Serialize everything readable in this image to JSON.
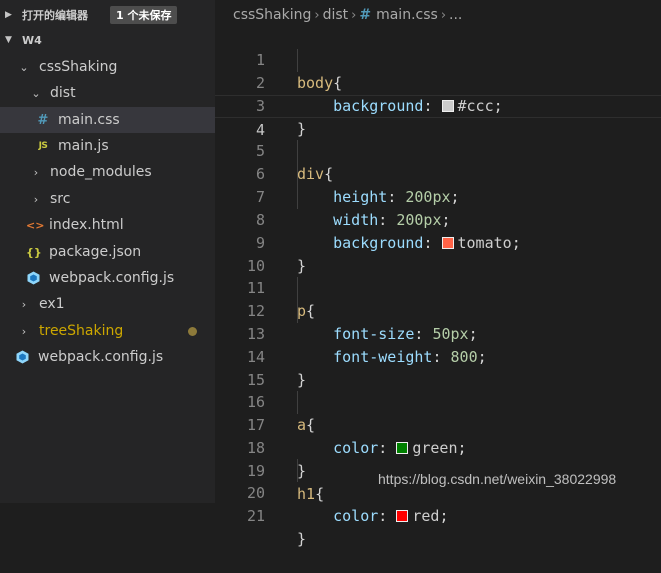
{
  "sidebar": {
    "open_editors": {
      "title": "打开的编辑器",
      "badge": "1 个未保存"
    },
    "workspace": {
      "title": "W4"
    },
    "tree": [
      {
        "label": "cssShaking",
        "kind": "folder",
        "open": true
      },
      {
        "label": "dist",
        "kind": "folder",
        "open": true
      },
      {
        "label": "main.css",
        "kind": "css",
        "icon": "#"
      },
      {
        "label": "main.js",
        "kind": "js",
        "icon": "JS"
      },
      {
        "label": "node_modules",
        "kind": "folder",
        "open": false
      },
      {
        "label": "src",
        "kind": "folder",
        "open": false
      },
      {
        "label": "index.html",
        "kind": "html",
        "icon": "<>"
      },
      {
        "label": "package.json",
        "kind": "json",
        "icon": "{}"
      },
      {
        "label": "webpack.config.js",
        "kind": "webpack"
      },
      {
        "label": "ex1",
        "kind": "folder",
        "open": false
      },
      {
        "label": "treeShaking",
        "kind": "folder",
        "open": false,
        "modified": true
      },
      {
        "label": "webpack.config.js",
        "kind": "webpack"
      }
    ]
  },
  "breadcrumb": {
    "parts": [
      "cssShaking",
      "dist",
      "main.css",
      "..."
    ],
    "file_icon": "#"
  },
  "editor": {
    "line_numbers": [
      "1",
      "2",
      "3",
      "4",
      "5",
      "6",
      "7",
      "8",
      "9",
      "10",
      "11",
      "12",
      "13",
      "14",
      "15",
      "16",
      "17",
      "18",
      "19",
      "20",
      "21"
    ],
    "code": {
      "l1_sel": "body",
      "l1_brace": "{",
      "l2_prop": "background",
      "l2_colon": ": ",
      "l2_val": "#ccc",
      "l2_semi": ";",
      "l3": "}",
      "l5_sel": "div",
      "l5_brace": "{",
      "l6_prop": "height",
      "l6_colon": ": ",
      "l6_val": "200px",
      "l6_semi": ";",
      "l7_prop": "width",
      "l7_colon": ": ",
      "l7_val": "200px",
      "l7_semi": ";",
      "l8_prop": "background",
      "l8_colon": ": ",
      "l8_val": "tomato",
      "l8_semi": ";",
      "l9": "}",
      "l11_sel": "p",
      "l11_brace": "{",
      "l12_prop": "font-size",
      "l12_colon": ": ",
      "l12_val": "50px",
      "l12_semi": ";",
      "l13_prop": "font-weight",
      "l13_colon": ": ",
      "l13_val": "800",
      "l13_semi": ";",
      "l14": "}",
      "l16_sel": "a",
      "l16_brace": "{",
      "l17_prop": "color",
      "l17_colon": ": ",
      "l17_val": "green",
      "l17_semi": ";",
      "l18": "}",
      "l19_sel": "h1",
      "l19_brace": "{",
      "l20_prop": "color",
      "l20_colon": ": ",
      "l20_val": "red",
      "l20_semi": ";",
      "l21": "}"
    },
    "swatches": {
      "ccc": "#cccccc",
      "tomato": "#ff6347",
      "green": "#008000",
      "red": "#ff0000"
    }
  },
  "watermark": "https://blog.csdn.net/weixin_38022998"
}
